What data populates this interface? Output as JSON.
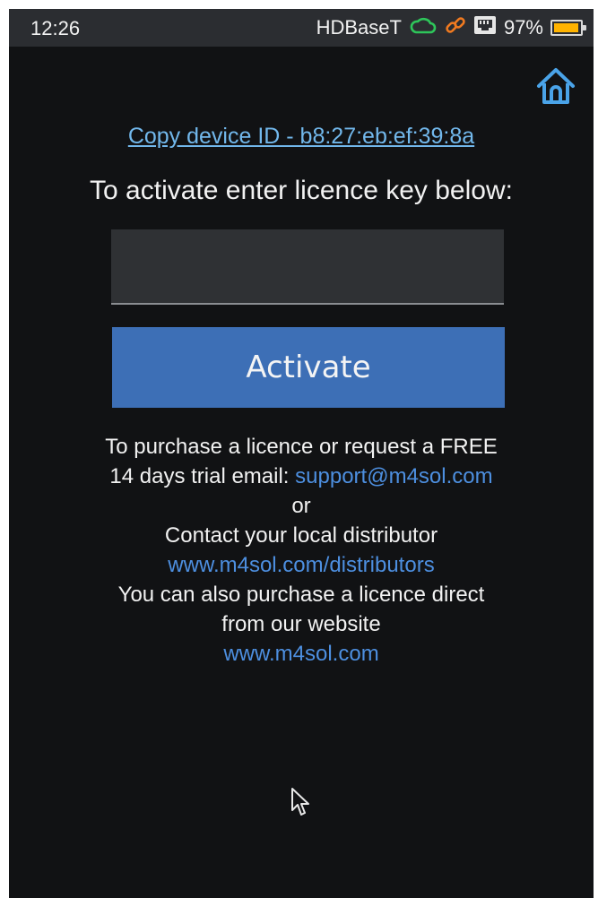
{
  "status_bar": {
    "time": "12:26",
    "network": "HDBaseT",
    "battery_percent": "97%",
    "battery_level": 0.97,
    "icons": [
      "cloud-icon",
      "link-icon",
      "ethernet-icon",
      "battery-icon"
    ],
    "colors": {
      "cloud": "#2ec55a",
      "link": "#f07a20",
      "battery": "#ffb300"
    }
  },
  "header": {
    "home_icon": "home-icon",
    "copy_device_id": "Copy device ID - b8:27:eb:ef:39:8a"
  },
  "activation": {
    "prompt": "To activate enter licence key below:",
    "licence_value": "",
    "activate_label": "Activate"
  },
  "info": {
    "line1": "To purchase a licence or request a FREE",
    "line2_text": "14 days trial email: ",
    "support_email": "support@m4sol.com",
    "or": "or",
    "contact": "Contact your local distributor",
    "distributors_link": "www.m4sol.com/distributors",
    "purchase_line1": "You can also purchase a licence direct",
    "purchase_line2": "from our website",
    "website_link": "www.m4sol.com"
  },
  "colors": {
    "background": "#111214",
    "status_bar": "#2b2d31",
    "accent_button": "#3d6fb6",
    "link": "#4d8fe0",
    "copy_link": "#72b8ec"
  }
}
